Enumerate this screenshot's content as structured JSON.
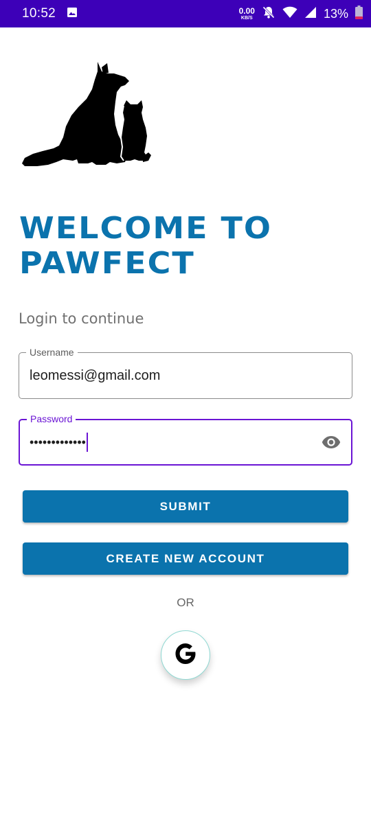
{
  "status_bar": {
    "time": "10:52",
    "net_speed_value": "0.00",
    "net_speed_unit": "KB/S",
    "battery_percent": "13%",
    "icons": [
      "image-icon",
      "bell-off-icon",
      "wifi-icon",
      "signal-icon",
      "battery-icon"
    ],
    "background_color": "#3d00b8"
  },
  "logo": {
    "icon": "dog-and-cat-silhouette-icon"
  },
  "welcome": {
    "line1": "WELCOME TO",
    "line2": "PAWFECT",
    "color": "#0b73ad"
  },
  "subtitle": "Login to continue",
  "username_field": {
    "label": "Username",
    "value": "leomessi@gmail.com"
  },
  "password_field": {
    "label": "Password",
    "value": "•••••••••••••",
    "focused": true,
    "toggle_icon": "eye-icon",
    "accent_color": "#6a14d4"
  },
  "buttons": {
    "submit": "SUBMIT",
    "create_account": "CREATE NEW ACCOUNT",
    "color": "#0b73ad"
  },
  "separator": "OR",
  "google_signin": {
    "icon": "google-g-icon"
  }
}
